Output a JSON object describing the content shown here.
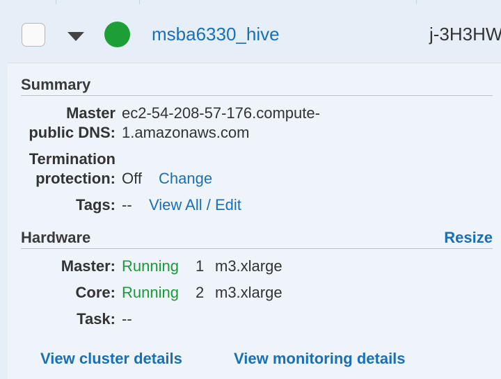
{
  "cluster": {
    "name": "msba6330_hive",
    "id": "j-3H3HW"
  },
  "colors": {
    "link": "#1a6fb5",
    "running": "#1b9a37",
    "status_dot": "#1e9e36"
  },
  "summary": {
    "title": "Summary",
    "dns_label_1": "Master",
    "dns_label_2": "public DNS:",
    "dns_value_1": "ec2-54-208-57-176.compute-",
    "dns_value_2": "1.amazonaws.com",
    "termination_label_1": "Termination",
    "termination_label_2": "protection:",
    "termination_value": "Off",
    "termination_action": "Change",
    "tags_label": "Tags:",
    "tags_value": "--",
    "tags_action": "View All / Edit"
  },
  "hardware": {
    "title": "Hardware",
    "action": "Resize",
    "rows": [
      {
        "label": "Master:",
        "status": "Running",
        "count": "1",
        "type": "m3.xlarge"
      },
      {
        "label": "Core:",
        "status": "Running",
        "count": "2",
        "type": "m3.xlarge"
      },
      {
        "label": "Task:",
        "value": "--"
      }
    ]
  },
  "links": {
    "cluster_details": "View cluster details",
    "monitoring_details": "View monitoring details"
  }
}
